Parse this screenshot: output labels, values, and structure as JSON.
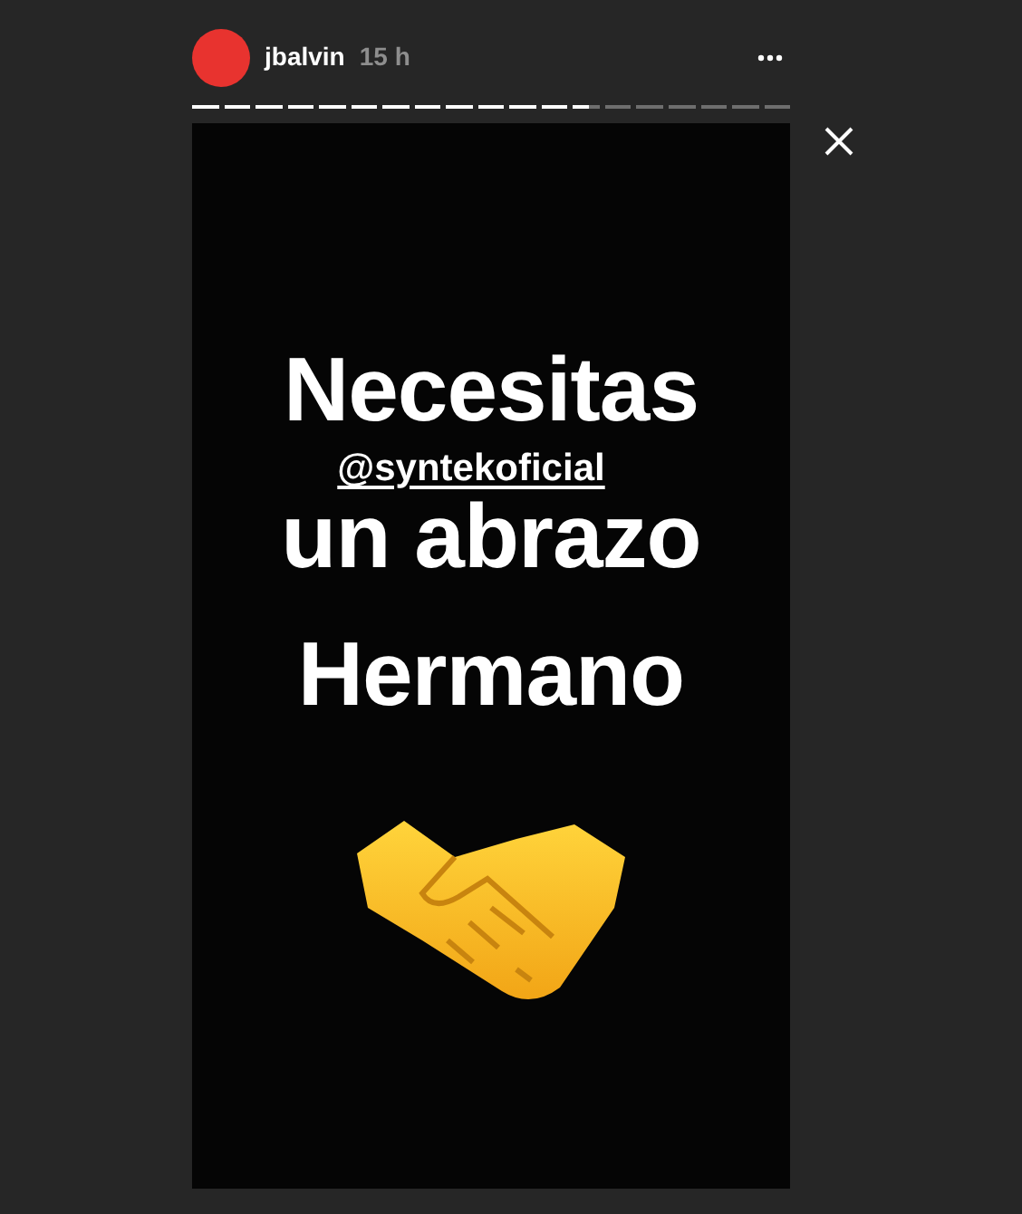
{
  "story": {
    "user": "jbalvin",
    "time": "15 h",
    "progress": [
      {
        "level": 1
      },
      {
        "level": 1
      },
      {
        "level": 1
      },
      {
        "level": 1
      },
      {
        "level": 1
      },
      {
        "level": 1
      },
      {
        "level": 1
      },
      {
        "level": 1
      },
      {
        "level": 1
      },
      {
        "level": 1
      },
      {
        "level": 1
      },
      {
        "level": 1
      },
      {
        "level": 0.6
      },
      {
        "level": 0
      },
      {
        "level": 0
      },
      {
        "level": 0
      },
      {
        "level": 0
      },
      {
        "level": 0
      },
      {
        "level": 0
      }
    ],
    "overlay": [
      {
        "kind": "headline",
        "text": "Necesitas"
      },
      {
        "kind": "mention",
        "text": "@syntekoficial"
      },
      {
        "kind": "headline",
        "text": "un abrazo"
      },
      {
        "kind": "headline",
        "text": "Hermano"
      },
      {
        "kind": "handshake"
      }
    ]
  }
}
